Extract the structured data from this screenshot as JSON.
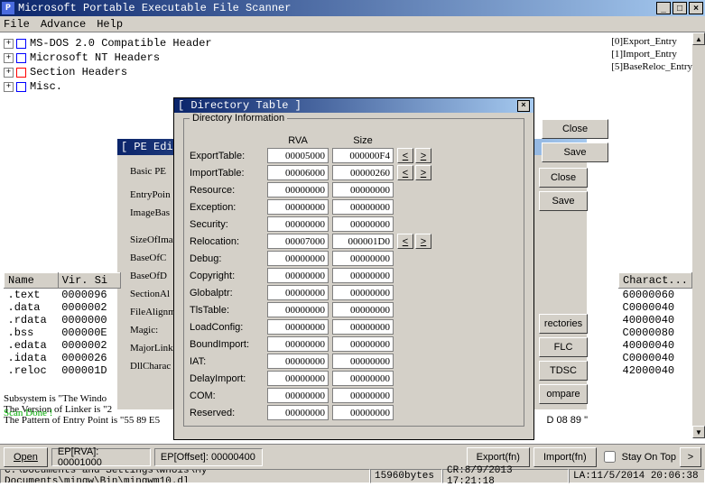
{
  "app": {
    "icon_letter": "P",
    "title": "Microsoft Portable Executable File Scanner"
  },
  "menu": {
    "file": "File",
    "advance": "Advance",
    "help": "Help"
  },
  "tree": {
    "n0": "MS-DOS 2.0 Compatible Header",
    "n1": "Microsoft NT Headers",
    "n2": "Section Headers",
    "n3": "Misc."
  },
  "exports": {
    "e0": "[0]Export_Entry",
    "e1": "[1]Import_Entry",
    "e2": "[5]BaseReloc_Entry"
  },
  "sections": {
    "h_name": "Name",
    "h_vsize": "Vir. Si",
    "rows": [
      {
        "name": ".text",
        "vsize": "0000096"
      },
      {
        "name": ".data",
        "vsize": "0000002"
      },
      {
        "name": ".rdata",
        "vsize": "0000000"
      },
      {
        "name": ".bss",
        "vsize": "000000E"
      },
      {
        "name": ".edata",
        "vsize": "0000002"
      },
      {
        "name": ".idata",
        "vsize": "0000026"
      },
      {
        "name": ".reloc",
        "vsize": "000001D"
      }
    ]
  },
  "charact": {
    "h": "Charact...",
    "vals": [
      "60000060",
      "C0000040",
      "40000040",
      "C0000080",
      "40000040",
      "C0000040",
      "42000040"
    ]
  },
  "peedit": {
    "title": "[ PE Edito",
    "legend": "Basic PE",
    "labels": [
      "EntryPoin",
      "ImageBas",
      "SizeOfIma",
      "BaseOfC",
      "BaseOfD",
      "SectionAl",
      "FileAlignm",
      "Magic:",
      "MajorLink",
      "DllCharac"
    ]
  },
  "pe_buttons": {
    "close": "Close",
    "save": "Save",
    "rect": "rectories",
    "flc": "FLC",
    "tdsc": "TDSC",
    "compare": "ompare"
  },
  "dlg": {
    "title": "[ Directory Table ]",
    "legend": "Directory Information",
    "h_rva": "RVA",
    "h_size": "Size",
    "rows": [
      {
        "label": "ExportTable:",
        "rva": "00005000",
        "size": "000000F4",
        "nav": true
      },
      {
        "label": "ImportTable:",
        "rva": "00006000",
        "size": "00000260",
        "nav": true
      },
      {
        "label": "Resource:",
        "rva": "00000000",
        "size": "00000000"
      },
      {
        "label": "Exception:",
        "rva": "00000000",
        "size": "00000000"
      },
      {
        "label": "Security:",
        "rva": "00000000",
        "size": "00000000"
      },
      {
        "label": "Relocation:",
        "rva": "00007000",
        "size": "000001D0",
        "nav": true
      },
      {
        "label": "Debug:",
        "rva": "00000000",
        "size": "00000000"
      },
      {
        "label": "Copyright:",
        "rva": "00000000",
        "size": "00000000"
      },
      {
        "label": "Globalptr:",
        "rva": "00000000",
        "size": "00000000"
      },
      {
        "label": "TlsTable:",
        "rva": "00000000",
        "size": "00000000"
      },
      {
        "label": "LoadConfig:",
        "rva": "00000000",
        "size": "00000000"
      },
      {
        "label": "BoundImport:",
        "rva": "00000000",
        "size": "00000000"
      },
      {
        "label": "IAT:",
        "rva": "00000000",
        "size": "00000000"
      },
      {
        "label": "DelayImport:",
        "rva": "00000000",
        "size": "00000000"
      },
      {
        "label": "COM:",
        "rva": "00000000",
        "size": "00000000"
      },
      {
        "label": "Reserved:",
        "rva": "00000000",
        "size": "00000000"
      }
    ]
  },
  "side": {
    "close": "Close",
    "save": "Save"
  },
  "status": {
    "l0": "Subsystem is \"The Windo",
    "l1": "The Version of Linker is \"2",
    "l2": "The Pattern of Entry Point is \"55 89 E5",
    "l3": "D 08 89 \"",
    "scan": "Scan Done !"
  },
  "bottom": {
    "open": "Open",
    "eprva": "EP[RVA]: 00001000",
    "epoffset": "EP[Offset]: 00000400",
    "exportfn": "Export(fn)",
    "importfn": "Import(fn)",
    "stayontop": "Stay On Top",
    "arrow": ">"
  },
  "statusbar": {
    "path": "C:\\Documents and Settings\\Whois\\My Documents\\mingw\\Bin\\mingwm10.dl",
    "bytes": "15960bytes",
    "cr": "CR:8/9/2013 17:21:18",
    "la": "LA:11/5/2014 20:06:38"
  }
}
